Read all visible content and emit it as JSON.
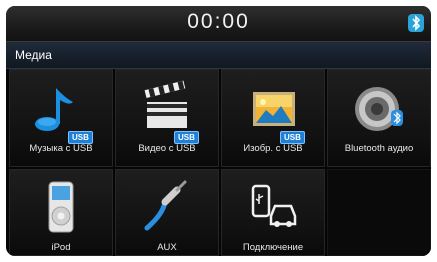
{
  "status_bar": {
    "time": "00:00"
  },
  "header": {
    "title": "Медиа"
  },
  "badge_text": "USB",
  "tiles": [
    {
      "label": "Музыка с USB",
      "icon": "music-note-usb-icon"
    },
    {
      "label": "Видео с USB",
      "icon": "clapperboard-usb-icon"
    },
    {
      "label": "Изобр. с USB",
      "icon": "picture-usb-icon"
    },
    {
      "label": "Bluetooth аудио",
      "icon": "speaker-bluetooth-icon"
    },
    {
      "label": "iPod",
      "icon": "ipod-icon"
    },
    {
      "label": "AUX",
      "icon": "aux-cable-icon"
    },
    {
      "label": "Подключение",
      "icon": "phone-car-connection-icon"
    }
  ],
  "colors": {
    "accent": "#1e7fd6",
    "background": "#050505",
    "tile": "#161616"
  }
}
